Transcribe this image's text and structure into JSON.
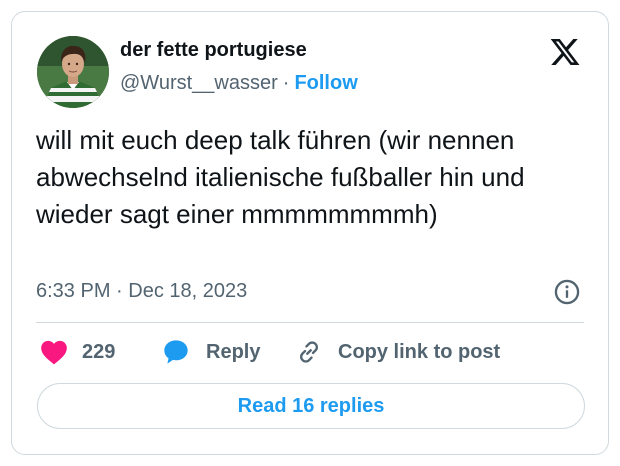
{
  "author": {
    "display_name": "der fette portugiese",
    "handle": "@Wurst__wasser",
    "separator": "·",
    "follow_label": "Follow",
    "avatar_icon": "profile-photo"
  },
  "platform": {
    "logo_icon": "x-logo-icon"
  },
  "tweet": {
    "text": "will mit euch deep talk führen (wir nennen abwechselnd italienische fußballer hin und wieder sagt einer mmmmmmmmh)",
    "timestamp": "6:33 PM · Dec 18, 2023",
    "info_icon": "info-icon"
  },
  "actions": {
    "like_count": "229",
    "like_icon": "heart-icon",
    "reply_label": "Reply",
    "reply_icon": "speech-bubble-icon",
    "copy_label": "Copy link to post",
    "copy_icon": "link-icon"
  },
  "footer": {
    "read_replies_label": "Read 16 replies"
  },
  "colors": {
    "accent": "#1d9bf0",
    "like": "#f91880",
    "text_primary": "#0f1419",
    "text_secondary": "#536471",
    "border": "#cfd9de"
  }
}
